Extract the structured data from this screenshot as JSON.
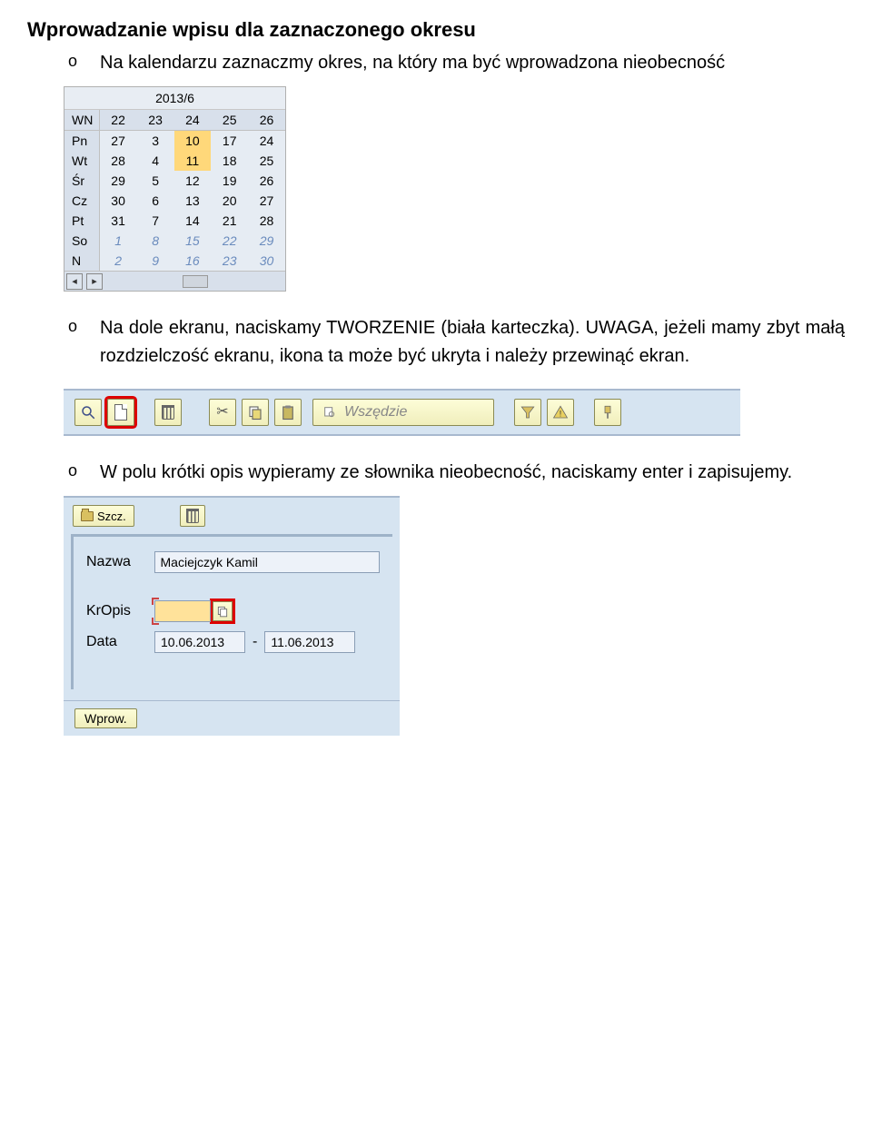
{
  "heading": "Wprowadzanie wpisu dla zaznaczonego okresu",
  "bullets": {
    "b1": "Na kalendarzu zaznaczmy okres, na który ma być wprowadzona nieobecność",
    "b2": "Na dole ekranu, naciskamy TWORZENIE (biała karteczka). UWAGA, jeżeli mamy zbyt małą rozdzielczość ekranu, ikona ta może być ukryta i należy przewinąć ekran.",
    "b3": "W polu krótki opis wypieramy ze słownika nieobecność, naciskamy enter i zapisujemy."
  },
  "calendar": {
    "title": "2013/6",
    "wn_label": "WN",
    "weeks": [
      "22",
      "23",
      "24",
      "25",
      "26"
    ],
    "row_labels": [
      "Pn",
      "Wt",
      "Śr",
      "Cz",
      "Pt",
      "So",
      "N"
    ],
    "grid": [
      [
        "27",
        "3",
        "10",
        "17",
        "24"
      ],
      [
        "28",
        "4",
        "11",
        "18",
        "25"
      ],
      [
        "29",
        "5",
        "12",
        "19",
        "26"
      ],
      [
        "30",
        "6",
        "13",
        "20",
        "27"
      ],
      [
        "31",
        "7",
        "14",
        "21",
        "28"
      ],
      [
        "1",
        "8",
        "15",
        "22",
        "29"
      ],
      [
        "2",
        "9",
        "16",
        "23",
        "30"
      ]
    ],
    "selected": [
      [
        0,
        2
      ],
      [
        1,
        2
      ]
    ],
    "bold": [
      [
        3,
        1
      ]
    ]
  },
  "toolbar": {
    "search_placeholder": "Wszędzie"
  },
  "form": {
    "szcz_label": "Szcz.",
    "name_label": "Nazwa",
    "name_value": "Maciejczyk Kamil",
    "kropis_label": "KrOpis",
    "data_label": "Data",
    "date_from": "10.06.2013",
    "date_sep": "-",
    "date_to": "11.06.2013",
    "wprow_label": "Wprow."
  }
}
